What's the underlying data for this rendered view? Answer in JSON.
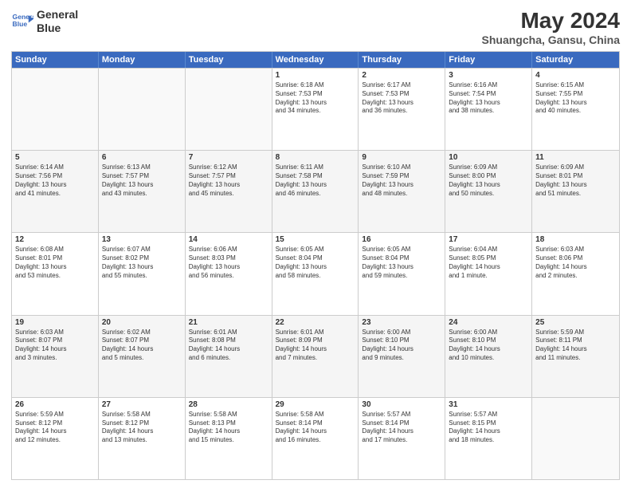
{
  "header": {
    "logo_line1": "General",
    "logo_line2": "Blue",
    "month_year": "May 2024",
    "location": "Shuangcha, Gansu, China"
  },
  "days_of_week": [
    "Sunday",
    "Monday",
    "Tuesday",
    "Wednesday",
    "Thursday",
    "Friday",
    "Saturday"
  ],
  "weeks": [
    [
      {
        "day": "",
        "info": ""
      },
      {
        "day": "",
        "info": ""
      },
      {
        "day": "",
        "info": ""
      },
      {
        "day": "1",
        "info": "Sunrise: 6:18 AM\nSunset: 7:53 PM\nDaylight: 13 hours\nand 34 minutes."
      },
      {
        "day": "2",
        "info": "Sunrise: 6:17 AM\nSunset: 7:53 PM\nDaylight: 13 hours\nand 36 minutes."
      },
      {
        "day": "3",
        "info": "Sunrise: 6:16 AM\nSunset: 7:54 PM\nDaylight: 13 hours\nand 38 minutes."
      },
      {
        "day": "4",
        "info": "Sunrise: 6:15 AM\nSunset: 7:55 PM\nDaylight: 13 hours\nand 40 minutes."
      }
    ],
    [
      {
        "day": "5",
        "info": "Sunrise: 6:14 AM\nSunset: 7:56 PM\nDaylight: 13 hours\nand 41 minutes."
      },
      {
        "day": "6",
        "info": "Sunrise: 6:13 AM\nSunset: 7:57 PM\nDaylight: 13 hours\nand 43 minutes."
      },
      {
        "day": "7",
        "info": "Sunrise: 6:12 AM\nSunset: 7:57 PM\nDaylight: 13 hours\nand 45 minutes."
      },
      {
        "day": "8",
        "info": "Sunrise: 6:11 AM\nSunset: 7:58 PM\nDaylight: 13 hours\nand 46 minutes."
      },
      {
        "day": "9",
        "info": "Sunrise: 6:10 AM\nSunset: 7:59 PM\nDaylight: 13 hours\nand 48 minutes."
      },
      {
        "day": "10",
        "info": "Sunrise: 6:09 AM\nSunset: 8:00 PM\nDaylight: 13 hours\nand 50 minutes."
      },
      {
        "day": "11",
        "info": "Sunrise: 6:09 AM\nSunset: 8:01 PM\nDaylight: 13 hours\nand 51 minutes."
      }
    ],
    [
      {
        "day": "12",
        "info": "Sunrise: 6:08 AM\nSunset: 8:01 PM\nDaylight: 13 hours\nand 53 minutes."
      },
      {
        "day": "13",
        "info": "Sunrise: 6:07 AM\nSunset: 8:02 PM\nDaylight: 13 hours\nand 55 minutes."
      },
      {
        "day": "14",
        "info": "Sunrise: 6:06 AM\nSunset: 8:03 PM\nDaylight: 13 hours\nand 56 minutes."
      },
      {
        "day": "15",
        "info": "Sunrise: 6:05 AM\nSunset: 8:04 PM\nDaylight: 13 hours\nand 58 minutes."
      },
      {
        "day": "16",
        "info": "Sunrise: 6:05 AM\nSunset: 8:04 PM\nDaylight: 13 hours\nand 59 minutes."
      },
      {
        "day": "17",
        "info": "Sunrise: 6:04 AM\nSunset: 8:05 PM\nDaylight: 14 hours\nand 1 minute."
      },
      {
        "day": "18",
        "info": "Sunrise: 6:03 AM\nSunset: 8:06 PM\nDaylight: 14 hours\nand 2 minutes."
      }
    ],
    [
      {
        "day": "19",
        "info": "Sunrise: 6:03 AM\nSunset: 8:07 PM\nDaylight: 14 hours\nand 3 minutes."
      },
      {
        "day": "20",
        "info": "Sunrise: 6:02 AM\nSunset: 8:07 PM\nDaylight: 14 hours\nand 5 minutes."
      },
      {
        "day": "21",
        "info": "Sunrise: 6:01 AM\nSunset: 8:08 PM\nDaylight: 14 hours\nand 6 minutes."
      },
      {
        "day": "22",
        "info": "Sunrise: 6:01 AM\nSunset: 8:09 PM\nDaylight: 14 hours\nand 7 minutes."
      },
      {
        "day": "23",
        "info": "Sunrise: 6:00 AM\nSunset: 8:10 PM\nDaylight: 14 hours\nand 9 minutes."
      },
      {
        "day": "24",
        "info": "Sunrise: 6:00 AM\nSunset: 8:10 PM\nDaylight: 14 hours\nand 10 minutes."
      },
      {
        "day": "25",
        "info": "Sunrise: 5:59 AM\nSunset: 8:11 PM\nDaylight: 14 hours\nand 11 minutes."
      }
    ],
    [
      {
        "day": "26",
        "info": "Sunrise: 5:59 AM\nSunset: 8:12 PM\nDaylight: 14 hours\nand 12 minutes."
      },
      {
        "day": "27",
        "info": "Sunrise: 5:58 AM\nSunset: 8:12 PM\nDaylight: 14 hours\nand 13 minutes."
      },
      {
        "day": "28",
        "info": "Sunrise: 5:58 AM\nSunset: 8:13 PM\nDaylight: 14 hours\nand 15 minutes."
      },
      {
        "day": "29",
        "info": "Sunrise: 5:58 AM\nSunset: 8:14 PM\nDaylight: 14 hours\nand 16 minutes."
      },
      {
        "day": "30",
        "info": "Sunrise: 5:57 AM\nSunset: 8:14 PM\nDaylight: 14 hours\nand 17 minutes."
      },
      {
        "day": "31",
        "info": "Sunrise: 5:57 AM\nSunset: 8:15 PM\nDaylight: 14 hours\nand 18 minutes."
      },
      {
        "day": "",
        "info": ""
      }
    ]
  ]
}
